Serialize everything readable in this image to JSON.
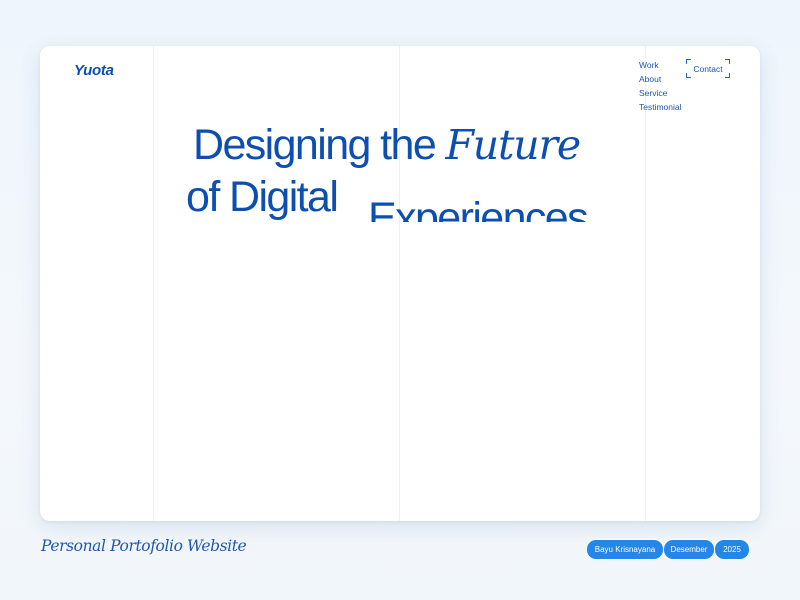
{
  "site": {
    "logo": "Yuota"
  },
  "nav": {
    "items": [
      {
        "label": "Work"
      },
      {
        "label": "About"
      },
      {
        "label": "Service"
      },
      {
        "label": "Testimonial"
      }
    ],
    "contact_label": "Contact"
  },
  "hero": {
    "line1_plain": "Designing the",
    "line1_italic": "Future",
    "line2": "of Digital",
    "line3": "Experiences"
  },
  "footer": {
    "caption": "Personal Portofolio Website",
    "author": "Bayu Krisnayana",
    "month": "Desember",
    "year": "2025"
  },
  "colors": {
    "brand": "#0d4fb0",
    "pill": "#2486e8",
    "background": "#eef4fb"
  }
}
